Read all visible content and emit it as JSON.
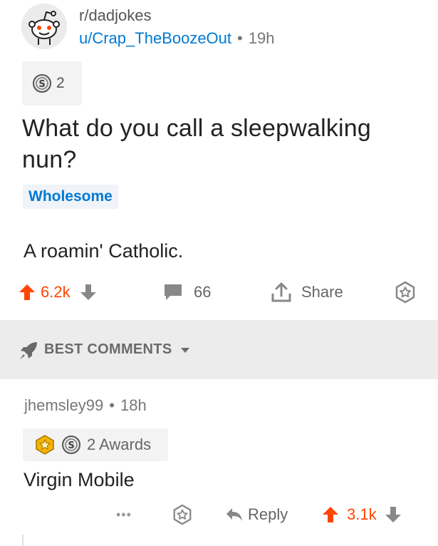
{
  "post": {
    "subreddit": "r/dadjokes",
    "author": "u/Crap_TheBoozeOut",
    "separator": "•",
    "age": "19h",
    "award_count": "2",
    "title": "What do you call a sleepwalking nun?",
    "flair": "Wholesome",
    "body": "A roamin' Catholic.",
    "score": "6.2k",
    "comment_count": "66",
    "share_label": "Share"
  },
  "comments_section": {
    "sort_label": "BEST COMMENTS"
  },
  "comment": {
    "author": "jhemsley99",
    "separator": "•",
    "age": "18h",
    "awards_label": "2 Awards",
    "body": "Virgin Mobile",
    "more_label": "•••",
    "reply_label": "Reply",
    "score": "3.1k"
  },
  "colors": {
    "upvote": "#ff4500",
    "link": "#0079d3",
    "icon": "#888888",
    "section_bg": "#ececec"
  }
}
